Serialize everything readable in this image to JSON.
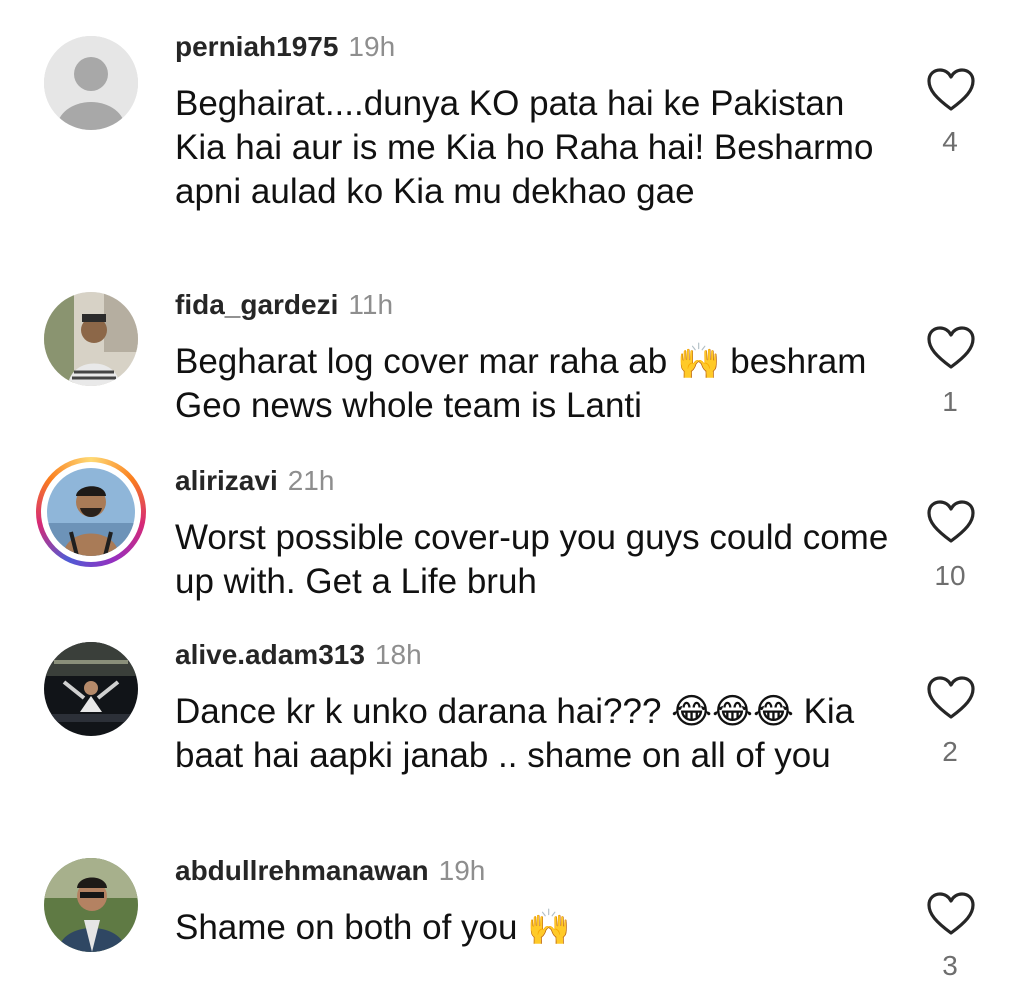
{
  "comments": [
    {
      "username": "perniah1975",
      "time": "19h",
      "text": "Beghairat....dunya KO pata hai ke Pakistan  Kia hai aur is me Kia ho Raha hai! Besharmo apni aulad ko Kia mu dekhao gae",
      "likes": "4",
      "avatar": "default-user-avatar"
    },
    {
      "username": "fida_gardezi",
      "time": "11h",
      "text": "Begharat log cover mar raha ab 🙌 beshram Geo news whole team is Lanti",
      "likes": "1",
      "avatar": "photo-avatar"
    },
    {
      "username": "alirizavi",
      "time": "21h",
      "text": "Worst possible cover-up you guys could come up with. Get a Life bruh",
      "likes": "10",
      "avatar": "story-ring-photo-avatar"
    },
    {
      "username": "alive.adam313",
      "time": "18h",
      "text": "Dance kr k unko darana hai??? 😂😂😂 Kia baat hai aapki janab .. shame on all of you",
      "likes": "2",
      "avatar": "photo-avatar"
    },
    {
      "username": "abdullrehmanawan",
      "time": "19h",
      "text": "Shame on both of you 🙌",
      "likes": "3",
      "avatar": "photo-avatar"
    }
  ],
  "colors": {
    "username": "#262626",
    "time": "#8e8e8e",
    "text": "#111111",
    "like_icon": "#262626",
    "like_count": "#6e6e6e",
    "story_ring": "#d62976"
  },
  "icons": {
    "like": "heart-outline-icon"
  }
}
